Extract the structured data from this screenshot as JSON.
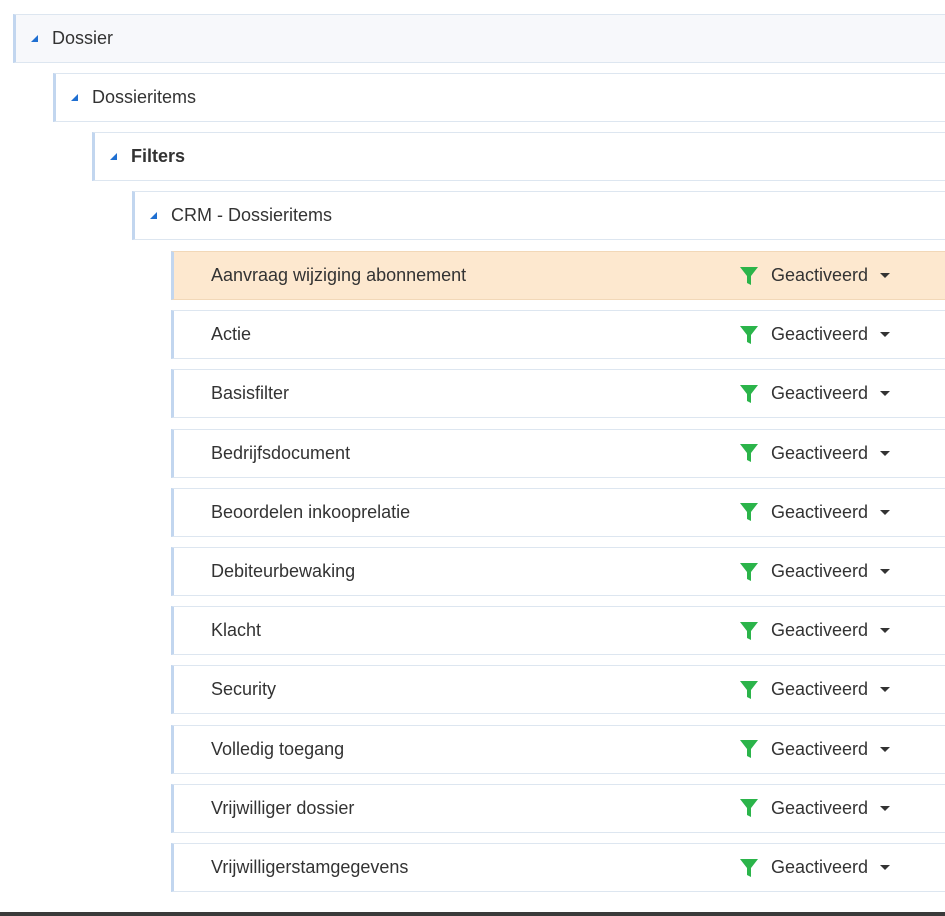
{
  "tree": {
    "nodes": [
      {
        "label": "Dossier",
        "level": 0
      },
      {
        "label": "Dossieritems",
        "level": 1
      },
      {
        "label": "Filters",
        "level": 2
      },
      {
        "label": "CRM - Dossieritems",
        "level": 3
      }
    ],
    "items": [
      {
        "label": "Aanvraag wijziging abonnement",
        "status": "Geactiveerd",
        "selected": true
      },
      {
        "label": "Actie",
        "status": "Geactiveerd"
      },
      {
        "label": "Basisfilter",
        "status": "Geactiveerd"
      },
      {
        "label": "Bedrijfsdocument",
        "status": "Geactiveerd"
      },
      {
        "label": "Beoordelen inkooprelatie",
        "status": "Geactiveerd"
      },
      {
        "label": "Debiteurbewaking",
        "status": "Geactiveerd"
      },
      {
        "label": "Klacht",
        "status": "Geactiveerd"
      },
      {
        "label": "Security",
        "status": "Geactiveerd"
      },
      {
        "label": "Volledig toegang",
        "status": "Geactiveerd"
      },
      {
        "label": "Vrijwilliger dossier",
        "status": "Geactiveerd"
      },
      {
        "label": "Vrijwilligerstamgegevens",
        "status": "Geactiveerd"
      }
    ]
  },
  "colors": {
    "filter_icon": "#2bb44a",
    "caret": "#1f6fd1",
    "selected_row": "#fde8cf"
  },
  "icons": {
    "expand": "caret-down-right-icon",
    "filter": "funnel-icon",
    "dropdown": "chevron-down-icon"
  }
}
